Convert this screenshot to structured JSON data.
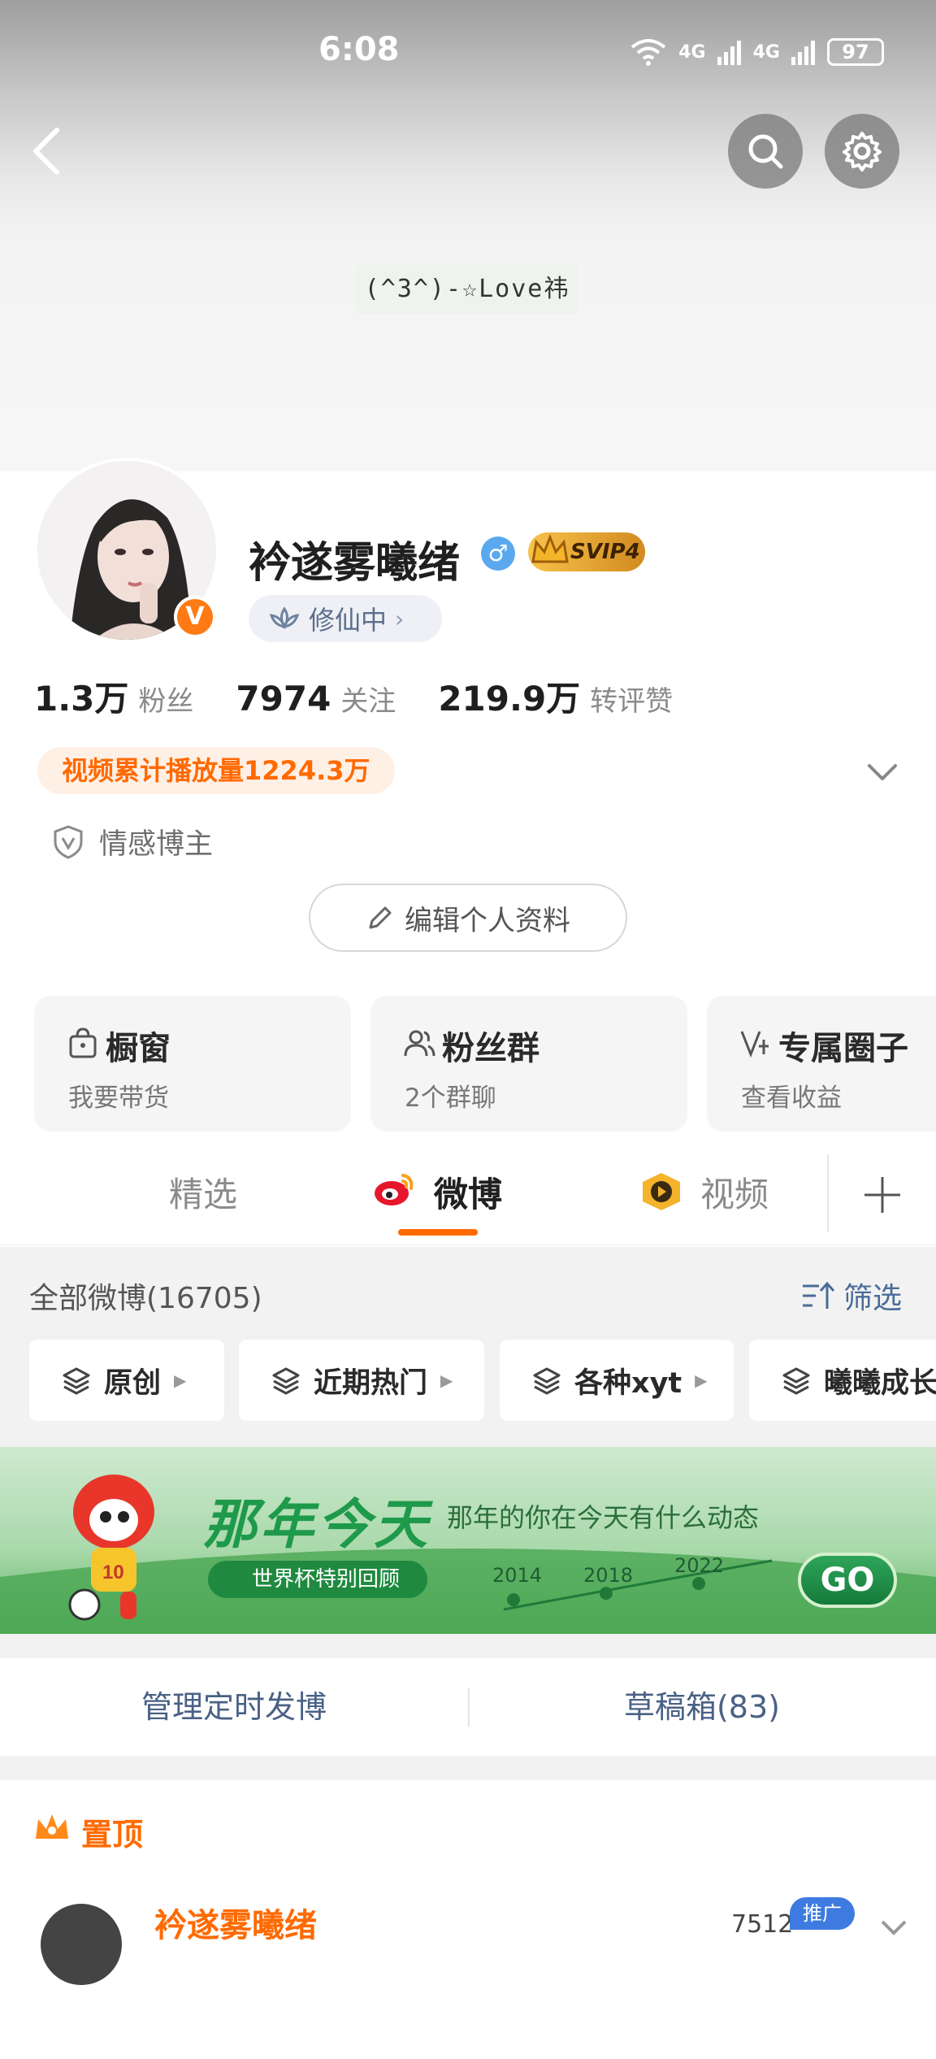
{
  "status_bar": {
    "time": "6:08",
    "signal_1": "4G",
    "signal_2": "4G",
    "battery": "97"
  },
  "header": {
    "banner_text": "(^3^)-☆Love祎"
  },
  "profile": {
    "username": "衿遂雾曦绪",
    "svip_label": "SVIP4",
    "status_chip": "修仙中",
    "stats": [
      {
        "value": "1.3万",
        "label": "粉丝"
      },
      {
        "value": "7974",
        "label": "关注"
      },
      {
        "value": "219.9万",
        "label": "转评赞"
      }
    ],
    "video_views": "视频累计播放量1224.3万",
    "role": "情感博主",
    "edit_button": "编辑个人资料"
  },
  "services": [
    {
      "title": "橱窗",
      "subtitle": "我要带货"
    },
    {
      "title": "粉丝群",
      "subtitle": "2个群聊"
    },
    {
      "title": "专属圈子",
      "subtitle": "查看收益"
    }
  ],
  "tabs": [
    {
      "label": "精选"
    },
    {
      "label": "微博"
    },
    {
      "label": "视频"
    }
  ],
  "feed": {
    "all_posts_label": "全部微博(16705)",
    "filter_label": "筛选",
    "chips": [
      {
        "label": "原创"
      },
      {
        "label": "近期热门"
      },
      {
        "label": "各种xyt"
      },
      {
        "label": "曦曦成长"
      }
    ]
  },
  "promo": {
    "title": "那年今天",
    "subtitle": "那年的你在今天有什么动态",
    "tag": "世界杯特别回顾",
    "years": [
      "2014",
      "2018",
      "2022"
    ],
    "go_label": "GO"
  },
  "manage": {
    "scheduled": "管理定时发博",
    "drafts": "草稿箱(83)"
  },
  "pinned": {
    "label": "置顶",
    "author": "衿遂雾曦绪",
    "ad_label": "推广",
    "ad_count": "7512"
  },
  "colors": {
    "accent_orange": "#ff6a00",
    "link_blue": "#4a6185",
    "verified_badge": "#ff7a15"
  }
}
